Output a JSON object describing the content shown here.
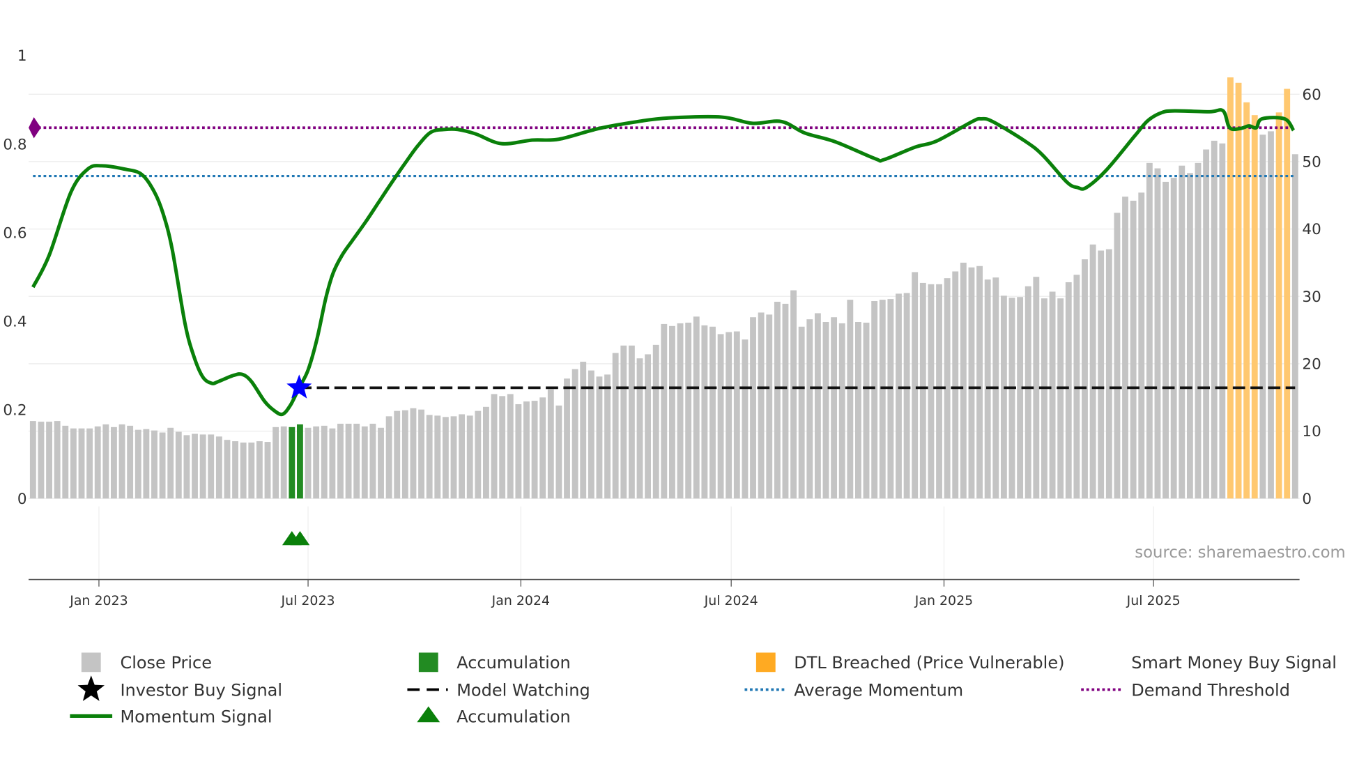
{
  "chart_data": {
    "type": "bar+line",
    "title": "",
    "x_unit": "week index (weekly bars)",
    "x_ticks": [
      {
        "label": "Jan 2023",
        "week": 8.15
      },
      {
        "label": "Jul 2023",
        "week": 34.0
      },
      {
        "label": "Jan 2024",
        "week": 60.3
      },
      {
        "label": "Jul 2024",
        "week": 86.3
      },
      {
        "label": "Jan 2025",
        "week": 112.6
      },
      {
        "label": "Jul 2025",
        "week": 138.5
      }
    ],
    "left_axis": {
      "range": [
        0,
        1
      ],
      "ticks": [
        "0",
        "0.2",
        "0.4",
        "0.6",
        "0.8",
        "1"
      ]
    },
    "right_axis": {
      "range": [
        0,
        60
      ],
      "ticks": [
        "0",
        "10",
        "20",
        "30",
        "40",
        "50",
        "60"
      ]
    },
    "close_price": [
      11.5,
      11.4,
      11.4,
      11.5,
      10.8,
      10.4,
      10.4,
      10.4,
      10.7,
      11,
      10.6,
      11,
      10.8,
      10.2,
      10.3,
      10.1,
      9.8,
      10.5,
      9.9,
      9.4,
      9.6,
      9.5,
      9.5,
      9.2,
      8.7,
      8.5,
      8.3,
      8.3,
      8.5,
      8.4,
      10.6,
      10.7,
      10.6,
      11,
      10.5,
      10.7,
      10.8,
      10.4,
      11.1,
      11.1,
      11.1,
      10.7,
      11.1,
      10.5,
      12.2,
      13,
      13.1,
      13.4,
      13.2,
      12.4,
      12.3,
      12.1,
      12.2,
      12.5,
      12.3,
      13,
      13.6,
      15.5,
      15.2,
      15.5,
      14,
      14.4,
      14.5,
      15,
      16.2,
      13.8,
      17.8,
      19.2,
      20.3,
      19,
      18.1,
      18.4,
      21.6,
      22.7,
      22.7,
      20.8,
      21.4,
      22.8,
      25.9,
      25.6,
      26,
      26.1,
      27,
      25.7,
      25.5,
      24.4,
      24.7,
      24.8,
      23.6,
      26.9,
      27.6,
      27.3,
      29.2,
      28.9,
      30.9,
      25.5,
      26.6,
      27.5,
      26.2,
      26.9,
      26,
      29.5,
      26.2,
      26.1,
      29.3,
      29.5,
      29.6,
      30.4,
      30.5,
      33.6,
      32,
      31.8,
      31.8,
      32.7,
      33.7,
      35,
      34.3,
      34.5,
      32.5,
      32.8,
      30.1,
      29.8,
      29.9,
      31.5,
      32.9,
      29.7,
      30.7,
      29.7,
      32.1,
      33.2,
      35.5,
      37.7,
      36.8,
      37,
      42.4,
      44.8,
      44.2,
      45.4,
      49.8,
      49,
      47,
      47.6,
      49.4,
      48.3,
      49.8,
      51.8,
      53.1,
      52.7,
      62.5,
      61.7,
      58.8,
      56.9,
      54,
      54.5,
      57.3,
      60.8,
      51.1
    ],
    "accumulation_weeks": [
      32,
      33
    ],
    "dtl_breached_weeks": [
      148,
      149,
      150,
      151,
      154,
      155
    ],
    "momentum": [
      [
        0,
        0.477
      ],
      [
        2,
        0.549
      ],
      [
        4.7,
        0.692
      ],
      [
        6.8,
        0.744
      ],
      [
        8.5,
        0.751
      ],
      [
        11.2,
        0.744
      ],
      [
        13.4,
        0.732
      ],
      [
        15,
        0.692
      ],
      [
        16.1,
        0.642
      ],
      [
        17.2,
        0.563
      ],
      [
        18.8,
        0.394
      ],
      [
        19.9,
        0.32
      ],
      [
        21,
        0.274
      ],
      [
        22.1,
        0.26
      ],
      [
        22.9,
        0.264
      ],
      [
        24.8,
        0.278
      ],
      [
        25.9,
        0.28
      ],
      [
        27,
        0.264
      ],
      [
        28.6,
        0.22
      ],
      [
        29.7,
        0.2
      ],
      [
        30.8,
        0.19
      ],
      [
        31.8,
        0.21
      ],
      [
        32.9,
        0.25
      ],
      [
        34,
        0.29
      ],
      [
        35.1,
        0.36
      ],
      [
        36.2,
        0.453
      ],
      [
        37.1,
        0.509
      ],
      [
        38.2,
        0.549
      ],
      [
        39.5,
        0.583
      ],
      [
        41.1,
        0.624
      ],
      [
        42.7,
        0.668
      ],
      [
        44.3,
        0.712
      ],
      [
        46,
        0.757
      ],
      [
        47.6,
        0.797
      ],
      [
        49.2,
        0.827
      ],
      [
        50.9,
        0.833
      ],
      [
        52.5,
        0.833
      ],
      [
        54.7,
        0.823
      ],
      [
        57.9,
        0.801
      ],
      [
        61.7,
        0.809
      ],
      [
        65,
        0.811
      ],
      [
        69.9,
        0.835
      ],
      [
        74.8,
        0.851
      ],
      [
        78.6,
        0.859
      ],
      [
        85.1,
        0.861
      ],
      [
        88.9,
        0.847
      ],
      [
        92.5,
        0.851
      ],
      [
        95.4,
        0.825
      ],
      [
        99.2,
        0.805
      ],
      [
        104.1,
        0.767
      ],
      [
        105.2,
        0.765
      ],
      [
        109,
        0.793
      ],
      [
        111.7,
        0.807
      ],
      [
        116.1,
        0.851
      ],
      [
        117.2,
        0.857
      ],
      [
        118.6,
        0.851
      ],
      [
        122.6,
        0.807
      ],
      [
        124.8,
        0.775
      ],
      [
        127.8,
        0.714
      ],
      [
        129.1,
        0.702
      ],
      [
        130.2,
        0.702
      ],
      [
        132.7,
        0.742
      ],
      [
        136.2,
        0.819
      ],
      [
        137.8,
        0.853
      ],
      [
        139.5,
        0.871
      ],
      [
        141.1,
        0.875
      ],
      [
        145.4,
        0.873
      ],
      [
        147.1,
        0.875
      ],
      [
        147.9,
        0.837
      ],
      [
        149.2,
        0.835
      ],
      [
        150.3,
        0.841
      ],
      [
        151.2,
        0.837
      ],
      [
        151.9,
        0.857
      ],
      [
        154.7,
        0.857
      ],
      [
        155.8,
        0.831
      ]
    ],
    "smart_money_buy_signal": {
      "week": 32.9,
      "value": 0.25
    },
    "model_watching_level": 0.25,
    "average_momentum": 0.728,
    "demand_threshold": 0.837,
    "legend_placement": "bottom",
    "colors": {
      "close_price": "#c4c4c4",
      "accumulation": "#228b22",
      "dtl": "#ffc870",
      "momentum": "#0a800a",
      "smart_money": "#0000ff",
      "average": "#1f77b4",
      "demand": "#800080"
    }
  },
  "legend": [
    {
      "label": "Close Price",
      "icon": "gray-square"
    },
    {
      "label": "Accumulation",
      "icon": "green-square"
    },
    {
      "label": "DTL Breached (Price Vulnerable)",
      "icon": "orange-square"
    },
    {
      "label": "Smart Money Buy Signal",
      "icon": "blue-star"
    },
    {
      "label": "Investor Buy Signal",
      "icon": "black-star"
    },
    {
      "label": "Model Watching",
      "icon": "black-dash"
    },
    {
      "label": "Average Momentum",
      "icon": "blue-dot-line"
    },
    {
      "label": "Demand Threshold",
      "icon": "purple-dot-line"
    },
    {
      "label": "Momentum Signal",
      "icon": "green-line"
    },
    {
      "label": "Accumulation",
      "icon": "green-triangle"
    }
  ],
  "source": "source: sharemaestro.com"
}
